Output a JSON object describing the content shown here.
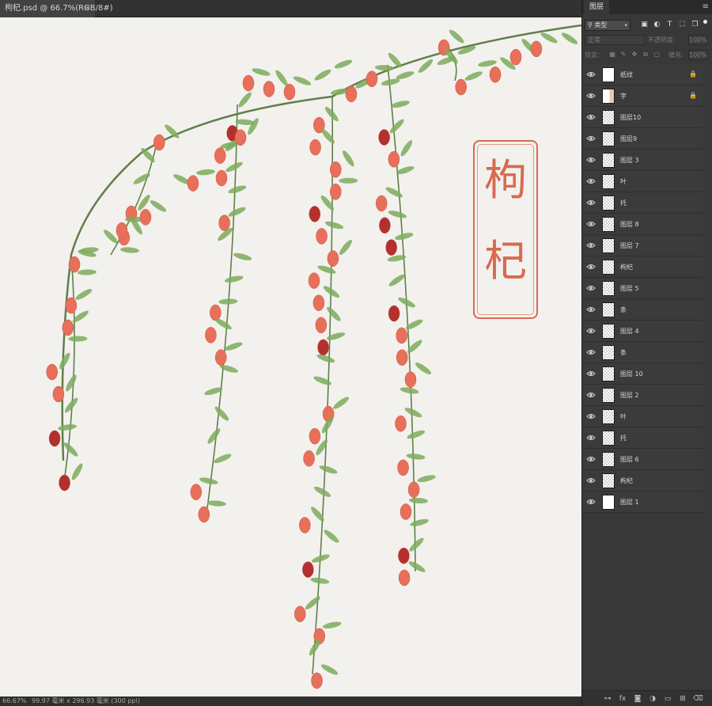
{
  "document": {
    "tab_title": "枸杞.psd @ 66.7%(RGB/8#)",
    "close_glyph": "×"
  },
  "canvas": {
    "paper_color": "#f3f1ee",
    "berry_color": "#e8705a",
    "dark_berry_color": "#b4302e",
    "leaf_color": "#7bab5c",
    "stem_color": "#5f7f4a",
    "seal": {
      "char_top": "枸",
      "char_bottom": "杞",
      "color": "#d86b4f"
    }
  },
  "statusbar": {
    "zoom": "66.67%",
    "doc_size": "99.97 毫米 x 296.93 毫米 (300 ppi)"
  },
  "panel": {
    "tab_label": "图层",
    "menu_glyph": "≡",
    "filter": {
      "kind_label": "类型",
      "search_glyph": "⚲",
      "chevron": "▾",
      "icons": [
        "image-filter-icon",
        "adjustment-filter-icon",
        "type-filter-icon",
        "shape-filter-icon",
        "smartobject-filter-icon"
      ]
    },
    "blend_mode": "正常",
    "opacity_label": "不透明度:",
    "opacity_value": "100%",
    "lock_label": "锁定:",
    "fill_label": "填充:",
    "fill_value": "100%",
    "layers": [
      {
        "name": "纸纹",
        "thumb": "white",
        "locked": true
      },
      {
        "name": "字",
        "thumb": "white-red",
        "locked": true
      },
      {
        "name": "图层10",
        "thumb": "checker",
        "locked": false
      },
      {
        "name": "图层9",
        "thumb": "checker",
        "locked": false
      },
      {
        "name": "图层 3",
        "thumb": "checker",
        "locked": false
      },
      {
        "name": "叶",
        "thumb": "checker",
        "locked": false
      },
      {
        "name": "托",
        "thumb": "checker",
        "locked": false
      },
      {
        "name": "图层 8",
        "thumb": "checker",
        "locked": false
      },
      {
        "name": "图层 7",
        "thumb": "checker",
        "locked": false
      },
      {
        "name": "枸杞",
        "thumb": "checker",
        "locked": false
      },
      {
        "name": "图层 5",
        "thumb": "checker",
        "locked": false
      },
      {
        "name": "条",
        "thumb": "checker",
        "locked": false
      },
      {
        "name": "图层 4",
        "thumb": "checker",
        "locked": false
      },
      {
        "name": "条",
        "thumb": "checker",
        "locked": false
      },
      {
        "name": "图层 10",
        "thumb": "checker",
        "locked": false
      },
      {
        "name": "图层 2",
        "thumb": "checker",
        "locked": false
      },
      {
        "name": "叶",
        "thumb": "checker",
        "locked": false
      },
      {
        "name": "托",
        "thumb": "checker",
        "locked": false
      },
      {
        "name": "图层 6",
        "thumb": "checker",
        "locked": false
      },
      {
        "name": "枸杞",
        "thumb": "checker",
        "locked": false
      },
      {
        "name": "图层 1",
        "thumb": "white",
        "locked": false
      }
    ],
    "lock_glyph": "🔒",
    "footer_icons": [
      "link-icon",
      "fx-icon",
      "mask-icon",
      "adjustment-icon",
      "folder-icon",
      "new-layer-icon",
      "trash-icon"
    ]
  }
}
